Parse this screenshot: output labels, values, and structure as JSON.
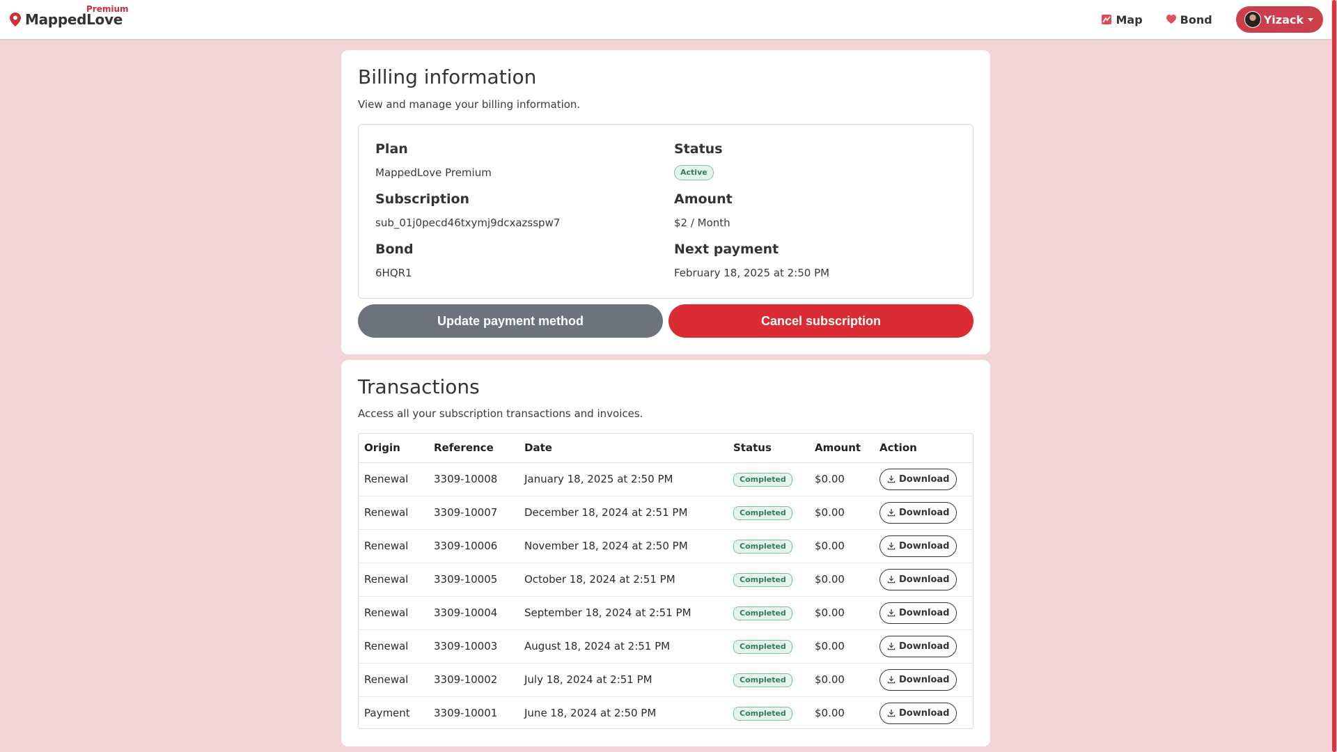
{
  "navbar": {
    "brand": "MappedLove",
    "premium_tag": "Premium",
    "links": [
      {
        "label": "Map",
        "icon": "map-icon"
      },
      {
        "label": "Bond",
        "icon": "heart-icon"
      }
    ],
    "user": {
      "name": "Yizack",
      "icon": "avatar"
    }
  },
  "billing": {
    "title": "Billing information",
    "subtitle": "View and manage your billing information.",
    "plan_label": "Plan",
    "plan_value": "MappedLove Premium",
    "status_label": "Status",
    "status_value": "Active",
    "subscription_label": "Subscription",
    "subscription_value": "sub_01j0pecd46txymj9dcxazsspw7",
    "amount_label": "Amount",
    "amount_value": "$2 / Month",
    "bond_label": "Bond",
    "bond_value": "6HQR1",
    "next_payment_label": "Next payment",
    "next_payment_value": "February 18, 2025 at 2:50 PM",
    "update_button": "Update payment method",
    "cancel_button": "Cancel subscription"
  },
  "transactions": {
    "title": "Transactions",
    "subtitle": "Access all your subscription transactions and invoices.",
    "columns": [
      "Origin",
      "Reference",
      "Date",
      "Status",
      "Amount",
      "Action"
    ],
    "rows": [
      {
        "origin": "Renewal",
        "reference": "3309-10008",
        "date": "January 18, 2025 at 2:50 PM",
        "status": "Completed",
        "amount": "$0.00",
        "action": "Download"
      },
      {
        "origin": "Renewal",
        "reference": "3309-10007",
        "date": "December 18, 2024 at 2:51 PM",
        "status": "Completed",
        "amount": "$0.00",
        "action": "Download"
      },
      {
        "origin": "Renewal",
        "reference": "3309-10006",
        "date": "November 18, 2024 at 2:50 PM",
        "status": "Completed",
        "amount": "$0.00",
        "action": "Download"
      },
      {
        "origin": "Renewal",
        "reference": "3309-10005",
        "date": "October 18, 2024 at 2:51 PM",
        "status": "Completed",
        "amount": "$0.00",
        "action": "Download"
      },
      {
        "origin": "Renewal",
        "reference": "3309-10004",
        "date": "September 18, 2024 at 2:51 PM",
        "status": "Completed",
        "amount": "$0.00",
        "action": "Download"
      },
      {
        "origin": "Renewal",
        "reference": "3309-10003",
        "date": "August 18, 2024 at 2:51 PM",
        "status": "Completed",
        "amount": "$0.00",
        "action": "Download"
      },
      {
        "origin": "Renewal",
        "reference": "3309-10002",
        "date": "July 18, 2024 at 2:51 PM",
        "status": "Completed",
        "amount": "$0.00",
        "action": "Download"
      },
      {
        "origin": "Payment",
        "reference": "3309-10001",
        "date": "June 18, 2024 at 2:50 PM",
        "status": "Completed",
        "amount": "$0.00",
        "action": "Download"
      }
    ]
  },
  "colors": {
    "background": "#f3d5d8",
    "brand_red": "#cc3e49",
    "cancel_red": "#db2c33",
    "update_gray": "#6c737c",
    "badge_green": "#2f7d5b"
  }
}
